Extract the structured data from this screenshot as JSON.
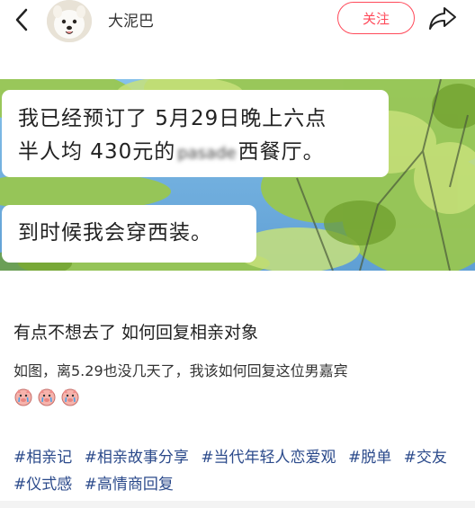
{
  "header": {
    "username": "大泥巴",
    "follow_label": "关注"
  },
  "image": {
    "bubble1_line1": "我已经预订了 5月29日晚上六点",
    "bubble1_line2_pre": "半人均 430元的",
    "bubble1_line2_blurred": "pasade",
    "bubble1_line2_post": "西餐厅。",
    "bubble2": "到时候我会穿西装。"
  },
  "post": {
    "title": "有点不想去了 如何回复相亲对象",
    "description": "如图，离5.29也没几天了，我该如何回复这位男嘉宾",
    "emoji_count": 3,
    "tags": [
      "#相亲记",
      "#相亲故事分享",
      "#当代年轻人恋爱观",
      "#脱单",
      "#交友",
      "#仪式感",
      "#高情商回复"
    ]
  },
  "colors": {
    "accent": "#ff4a5a",
    "tag": "#2b4a8b"
  }
}
